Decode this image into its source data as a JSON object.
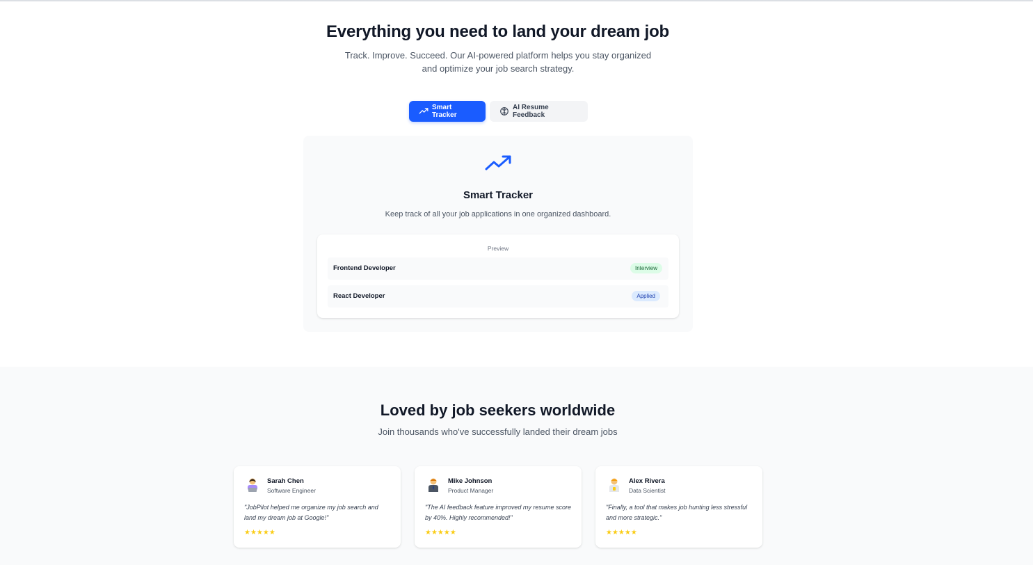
{
  "hero": {
    "title": "Everything you need to land your dream job",
    "subtitle": "Track. Improve. Succeed. Our AI-powered platform helps you stay organized and optimize your job search strategy."
  },
  "tabs": [
    {
      "label": "Smart Tracker",
      "icon": "trending-up-icon",
      "active": true
    },
    {
      "label": "AI Resume Feedback",
      "icon": "brain-icon",
      "active": false
    }
  ],
  "feature": {
    "icon": "trending-up-icon",
    "title": "Smart Tracker",
    "description": "Keep track of all your job applications in one organized dashboard.",
    "preview": {
      "label": "Preview",
      "rows": [
        {
          "title": "Frontend Developer",
          "status": "Interview",
          "status_color": "#166534",
          "status_bg": "#dcfce7"
        },
        {
          "title": "React Developer",
          "status": "Applied",
          "status_color": "#1e40af",
          "status_bg": "#dbeafe"
        }
      ]
    }
  },
  "testimonials": {
    "title": "Loved by job seekers worldwide",
    "subtitle": "Join thousands who've successfully landed their dream jobs",
    "items": [
      {
        "name": "Sarah Chen",
        "role": "Software Engineer",
        "avatar": "woman-technologist-emoji",
        "quote": "\"JobPilot helped me organize my job search and land my dream job at Google!\"",
        "rating": "★★★★★"
      },
      {
        "name": "Mike Johnson",
        "role": "Product Manager",
        "avatar": "man-office-worker-emoji",
        "quote": "\"The AI feedback feature improved my resume score by 40%. Highly recommended!\"",
        "rating": "★★★★★"
      },
      {
        "name": "Alex Rivera",
        "role": "Data Scientist",
        "avatar": "scientist-emoji",
        "quote": "\"Finally, a tool that makes job hunting less stressful and more strategic.\"",
        "rating": "★★★★★"
      }
    ]
  },
  "colors": {
    "primary": "#1a5cff",
    "star": "#facc15",
    "section_bg": "#f9fafb"
  }
}
